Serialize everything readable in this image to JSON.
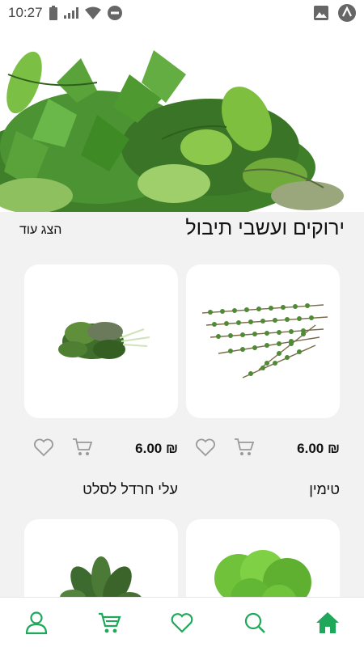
{
  "status_bar": {
    "time": "10:27",
    "icons": [
      "battery-icon",
      "signal-icon",
      "wifi-icon",
      "do-not-disturb-icon",
      "image-icon",
      "app-notification-icon"
    ]
  },
  "hero": {
    "icon": "herbs-banner-image"
  },
  "section": {
    "title": "ירוקים ועשבי תיבול",
    "show_more": "הצג עוד"
  },
  "products": [
    {
      "name": "טימין",
      "price": "₪ 6.00",
      "image": "thyme-image"
    },
    {
      "name": "עלי חרדל לסלט",
      "price": "₪ 6.00",
      "image": "mustard-leaves-image"
    },
    {
      "name": "",
      "price": "",
      "image": "lettuce-image"
    },
    {
      "name": "",
      "price": "",
      "image": "spinach-image"
    }
  ],
  "bottom_nav": [
    "home-icon",
    "search-icon",
    "heart-icon",
    "cart-icon",
    "user-icon"
  ],
  "colors": {
    "accent": "#1fa85a",
    "icon_gray": "#9a9a9a",
    "background": "#f2f2f2"
  }
}
